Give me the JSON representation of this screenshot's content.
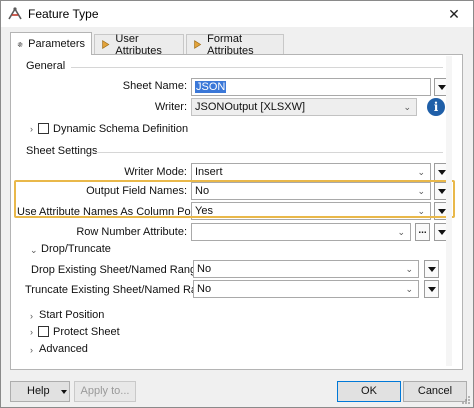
{
  "window": {
    "title": "Feature Type",
    "close_glyph": "✕"
  },
  "tabs": [
    {
      "label": "Parameters",
      "icon": "gear-icon",
      "active": true
    },
    {
      "label": "User Attributes",
      "icon": "arrow-right-icon",
      "active": false
    },
    {
      "label": "Format Attributes",
      "icon": "arrow-right-icon",
      "active": false
    }
  ],
  "general": {
    "heading": "General",
    "sheet_name_label": "Sheet Name:",
    "sheet_name_value": "JSON",
    "writer_label": "Writer:",
    "writer_value": "JSONOutput [XLSXW]",
    "info_glyph": "i",
    "dynamic_schema_label": "Dynamic Schema Definition"
  },
  "sheet_settings": {
    "heading": "Sheet Settings",
    "writer_mode_label": "Writer Mode:",
    "writer_mode_value": "Insert",
    "output_field_names_label": "Output Field Names:",
    "output_field_names_value": "No",
    "use_attr_names_label": "Use Attribute Names As Column Positions:",
    "use_attr_names_value": "Yes",
    "row_number_attr_label": "Row Number Attribute:",
    "row_number_attr_value": "",
    "dots_glyph": "...",
    "drop_truncate_heading": "Drop/Truncate",
    "drop_existing_label": "Drop Existing Sheet/Named Range:",
    "drop_existing_value": "No",
    "truncate_existing_label": "Truncate Existing Sheet/Named Range:",
    "truncate_existing_value": "No",
    "start_position_label": "Start Position",
    "protect_sheet_label": "Protect Sheet",
    "advanced_label": "Advanced"
  },
  "footer": {
    "help_label": "Help",
    "apply_label": "Apply to...",
    "ok_label": "OK",
    "cancel_label": "Cancel"
  },
  "colors": {
    "highlight": "#e9b84a",
    "info": "#1f5fa8",
    "selection": "#3b78d8"
  }
}
